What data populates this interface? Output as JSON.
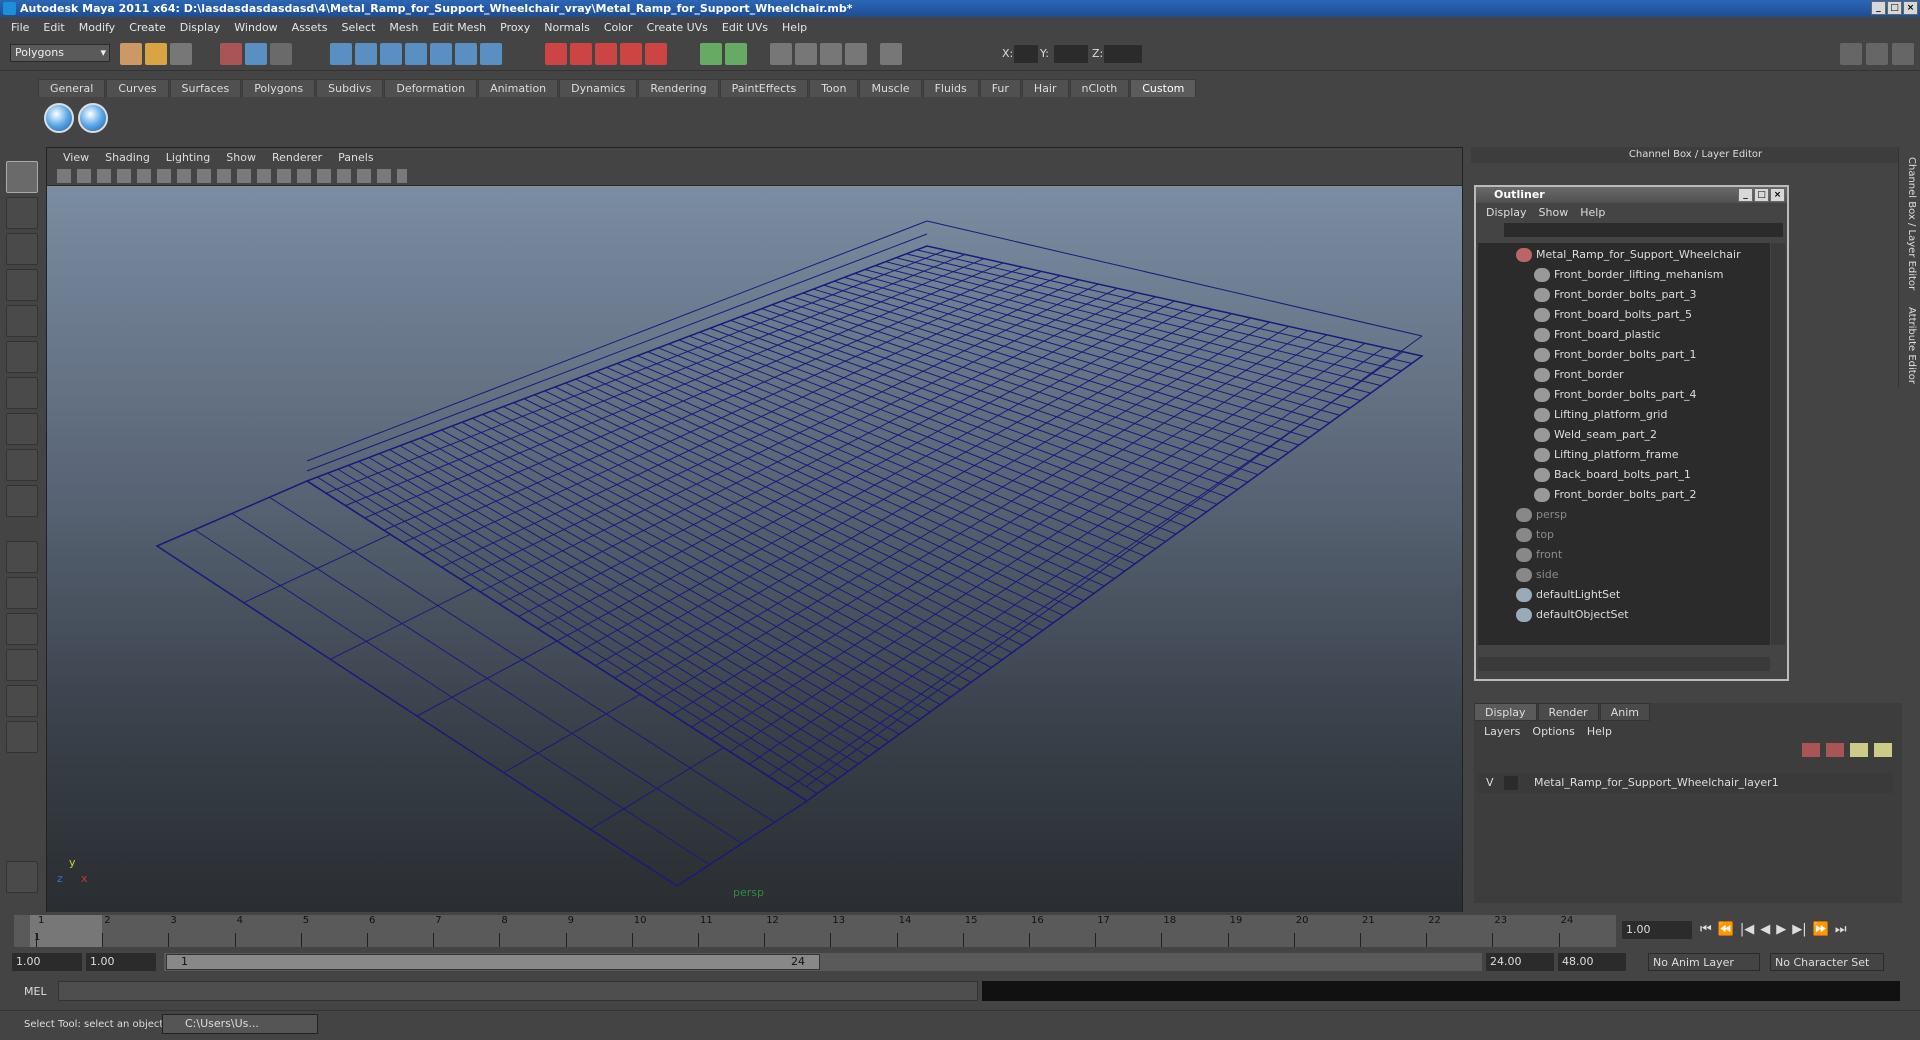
{
  "window": {
    "title": "Autodesk Maya 2011 x64: D:\\lasdasdasdasdasd\\4\\Metal_Ramp_for_Support_Wheelchair_vray\\Metal_Ramp_for_Support_Wheelchair.mb*"
  },
  "menu": [
    "File",
    "Edit",
    "Modify",
    "Create",
    "Display",
    "Window",
    "Assets",
    "Select",
    "Mesh",
    "Edit Mesh",
    "Proxy",
    "Normals",
    "Color",
    "Create UVs",
    "Edit UVs",
    "Help"
  ],
  "status": {
    "mode": "Polygons",
    "x_label": "X:",
    "y_label": "Y:",
    "z_label": "Z:"
  },
  "shelf_tabs": [
    "General",
    "Curves",
    "Surfaces",
    "Polygons",
    "Subdivs",
    "Deformation",
    "Animation",
    "Dynamics",
    "Rendering",
    "PaintEffects",
    "Toon",
    "Muscle",
    "Fluids",
    "Fur",
    "Hair",
    "nCloth",
    "Custom"
  ],
  "shelf_active": "Custom",
  "viewport": {
    "menu": [
      "View",
      "Shading",
      "Lighting",
      "Show",
      "Renderer",
      "Panels"
    ],
    "camera_label": "persp",
    "axis_y": "y",
    "axis_x": "x",
    "axis_z": "z",
    "wire_color": "#1a1a7a"
  },
  "channel_box": {
    "title": "Channel Box / Layer Editor"
  },
  "outliner": {
    "title": "Outliner",
    "menu": [
      "Display",
      "Show",
      "Help"
    ],
    "root": "Metal_Ramp_for_Support_Wheelchair",
    "children": [
      "Front_border_lifting_mehanism",
      "Front_border_bolts_part_3",
      "Front_board_bolts_part_5",
      "Front_board_plastic",
      "Front_border_bolts_part_1",
      "Front_border",
      "Front_border_bolts_part_4",
      "Lifting_platform_grid",
      "Weld_seam_part_2",
      "Lifting_platform_frame",
      "Back_board_bolts_part_1",
      "Front_border_bolts_part_2"
    ],
    "cameras": [
      "persp",
      "top",
      "front",
      "side"
    ],
    "sets": [
      "defaultLightSet",
      "defaultObjectSet"
    ]
  },
  "layers": {
    "tabs": [
      "Display",
      "Render",
      "Anim"
    ],
    "menu": [
      "Layers",
      "Options",
      "Help"
    ],
    "visibility": "V",
    "layer_name": "Metal_Ramp_for_Support_Wheelchair_layer1"
  },
  "timeline": {
    "ticks": [
      "1",
      "2",
      "3",
      "4",
      "5",
      "6",
      "7",
      "8",
      "9",
      "10",
      "11",
      "12",
      "13",
      "14",
      "15",
      "16",
      "17",
      "18",
      "19",
      "20",
      "21",
      "22",
      "23",
      "24"
    ],
    "current_frame": "1.00",
    "cursor_label": "1"
  },
  "range": {
    "start": "1.00",
    "start2": "1.00",
    "range_start": "1",
    "range_end": "24",
    "end": "24.00",
    "end2": "48.00",
    "anim_layer": "No Anim Layer",
    "char_set": "No Character Set"
  },
  "cmd": {
    "label": "MEL"
  },
  "help": {
    "text": "Select Tool: select an object",
    "task": "C:\\Users\\Us..."
  },
  "side_tabs": [
    "Channel Box / Layer Editor",
    "Attribute Editor"
  ]
}
